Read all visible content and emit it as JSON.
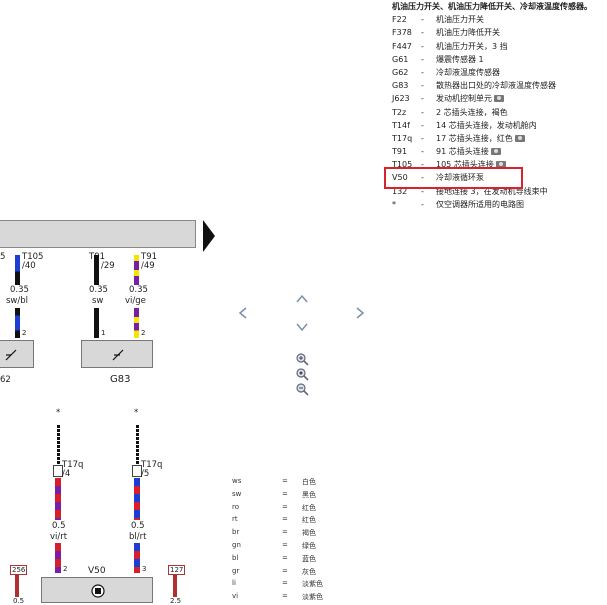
{
  "legend": {
    "title": "机油压力开关、机油压力降低开关、冷却液温度传感器。",
    "dash": "-",
    "items": [
      {
        "code": "F22",
        "desc": "机油压力开关",
        "camera": false
      },
      {
        "code": "F378",
        "desc": "机油压力降低开关",
        "camera": false
      },
      {
        "code": "F447",
        "desc": "机油压力开关，3 挡",
        "camera": false
      },
      {
        "code": "G61",
        "desc": "爆震传感器 1",
        "camera": false
      },
      {
        "code": "G62",
        "desc": "冷却液温度传感器",
        "camera": false
      },
      {
        "code": "G83",
        "desc": "散热器出口处的冷却液温度传感器",
        "camera": false
      },
      {
        "code": "J623",
        "desc": "发动机控制单元",
        "camera": true
      },
      {
        "code": "T2z",
        "desc": "2 芯插头连接，褐色",
        "camera": false
      },
      {
        "code": "T14f",
        "desc": "14 芯插头连接，发动机舱内",
        "camera": false
      },
      {
        "code": "T17q",
        "desc": "17 芯插头连接，红色",
        "camera": true
      },
      {
        "code": "T91",
        "desc": "91 芯插头连接",
        "camera": true
      },
      {
        "code": "T105",
        "desc": "105 芯插头连接",
        "camera": true
      },
      {
        "code": "V50",
        "desc": "冷却液循环泵",
        "camera": false
      },
      {
        "code": "132",
        "desc": "接地连接 3，在发动机导线束中",
        "camera": false
      },
      {
        "code": "*",
        "desc": "仅空调器所适用的电路图",
        "camera": false
      }
    ]
  },
  "diagram": {
    "connectors": {
      "left_top": "T105",
      "left_top_pin": "/40",
      "mid_top": "T91",
      "mid_top_pin": "/29",
      "right_top": "T91",
      "right_top_pin": "/49",
      "partial_left": "5",
      "t17q_a": "T17q",
      "t17q_a_pin": "/4",
      "t17q_b": "T17q",
      "t17q_b_pin": "/5"
    },
    "wires": {
      "w1_size": "0.35",
      "w1_color": "sw/bl",
      "w2_size": "0.35",
      "w2_color": "sw",
      "w3_size": "0.35",
      "w3_color": "vi/ge",
      "w4_size": "0.5",
      "w4_color": "vi/rt",
      "w5_size": "0.5",
      "w5_color": "bl/rt",
      "w6_size": "0.5",
      "w7_size": "2.5"
    },
    "pins": {
      "p1": "2",
      "p2": "1",
      "p3": "2",
      "p4": "2",
      "p5": "3"
    },
    "components": {
      "g83": "G83",
      "g62_partial": "62",
      "v50": "V50"
    },
    "asterisk": "*",
    "tags": {
      "t256": "256",
      "t127": "127"
    }
  },
  "color_codes": [
    {
      "code": "ws",
      "eq": "=",
      "name": "白色"
    },
    {
      "code": "sw",
      "eq": "=",
      "name": "黑色"
    },
    {
      "code": "ro",
      "eq": "=",
      "name": "红色"
    },
    {
      "code": "rt",
      "eq": "=",
      "name": "红色"
    },
    {
      "code": "br",
      "eq": "=",
      "name": "褐色"
    },
    {
      "code": "gn",
      "eq": "=",
      "name": "绿色"
    },
    {
      "code": "bl",
      "eq": "=",
      "name": "蓝色"
    },
    {
      "code": "gr",
      "eq": "=",
      "name": "灰色"
    },
    {
      "code": "li",
      "eq": "=",
      "name": "淡紫色"
    },
    {
      "code": "vi",
      "eq": "=",
      "name": "淡紫色"
    }
  ],
  "colors": {
    "highlight": "#d9232b",
    "wire_black": "#111111",
    "wire_blue": "#1d3fd1",
    "wire_violet": "#7a1fa3",
    "wire_yellow": "#f2e600",
    "wire_red": "#d4202a",
    "wire_darkred": "#b03030",
    "nav": "#7a8fa8"
  },
  "icons": [
    "camera-icon",
    "arrow-left-icon",
    "arrow-right-icon",
    "arrow-up-icon",
    "arrow-down-icon",
    "zoom-in-icon",
    "zoom-reset-icon",
    "zoom-out-icon"
  ]
}
